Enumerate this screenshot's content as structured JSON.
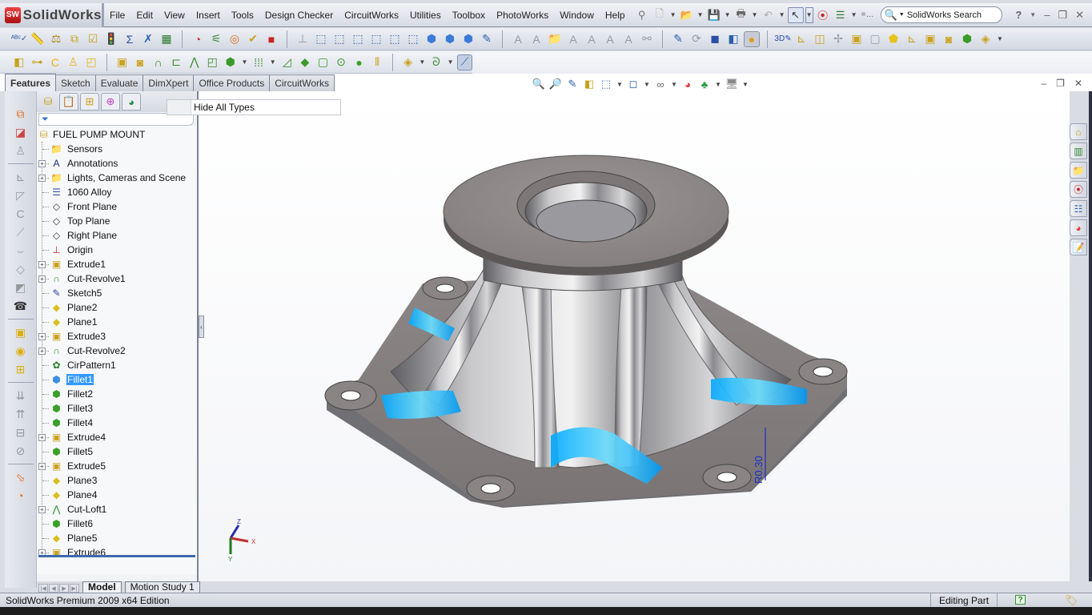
{
  "app": {
    "brand": "SolidWorks",
    "brand_badge": "SW"
  },
  "menu": [
    "File",
    "Edit",
    "View",
    "Insert",
    "Tools",
    "Design Checker",
    "CircuitWorks",
    "Utilities",
    "Toolbox",
    "PhotoWorks",
    "Window",
    "Help"
  ],
  "search": {
    "placeholder": "SolidWorks Search",
    "value": "SolidWorks Search"
  },
  "window_controls": {
    "help": "?",
    "minimize": "–",
    "restore": "❐",
    "close": "✕"
  },
  "command_tabs": [
    {
      "label": "Features",
      "active": true
    },
    {
      "label": "Sketch",
      "active": false
    },
    {
      "label": "Evaluate",
      "active": false
    },
    {
      "label": "DimXpert",
      "active": false
    },
    {
      "label": "Office Products",
      "active": false
    },
    {
      "label": "CircuitWorks",
      "active": false
    }
  ],
  "filter_popup": {
    "label": "Hide All Types"
  },
  "feature_tree": {
    "root": "FUEL PUMP MOUNT",
    "items": [
      {
        "label": "Sensors",
        "icon": "sensors-folder-icon",
        "expandable": false
      },
      {
        "label": "Annotations",
        "icon": "annotations-icon",
        "expandable": true
      },
      {
        "label": "Lights, Cameras and Scene",
        "icon": "lights-folder-icon",
        "expandable": true
      },
      {
        "label": "1060 Alloy",
        "icon": "material-icon",
        "expandable": false
      },
      {
        "label": "Front Plane",
        "icon": "plane-icon",
        "expandable": false
      },
      {
        "label": "Top Plane",
        "icon": "plane-icon",
        "expandable": false
      },
      {
        "label": "Right Plane",
        "icon": "plane-icon",
        "expandable": false
      },
      {
        "label": "Origin",
        "icon": "origin-icon",
        "expandable": false
      },
      {
        "label": "Extrude1",
        "icon": "extrude-icon",
        "expandable": true
      },
      {
        "label": "Cut-Revolve1",
        "icon": "cut-revolve-icon",
        "expandable": true
      },
      {
        "label": "Sketch5",
        "icon": "sketch-icon",
        "expandable": false
      },
      {
        "label": "Plane2",
        "icon": "ref-plane-icon",
        "expandable": false
      },
      {
        "label": "Plane1",
        "icon": "ref-plane-icon",
        "expandable": false
      },
      {
        "label": "Extrude3",
        "icon": "extrude-icon",
        "expandable": true
      },
      {
        "label": "Cut-Revolve2",
        "icon": "cut-revolve-icon",
        "expandable": true
      },
      {
        "label": "CirPattern1",
        "icon": "circular-pattern-icon",
        "expandable": false
      },
      {
        "label": "Fillet1",
        "icon": "fillet-icon",
        "expandable": false,
        "selected": true
      },
      {
        "label": "Fillet2",
        "icon": "fillet-icon",
        "expandable": false
      },
      {
        "label": "Fillet3",
        "icon": "fillet-icon",
        "expandable": false
      },
      {
        "label": "Fillet4",
        "icon": "fillet-icon",
        "expandable": false
      },
      {
        "label": "Extrude4",
        "icon": "extrude-icon",
        "expandable": true
      },
      {
        "label": "Fillet5",
        "icon": "fillet-icon",
        "expandable": false
      },
      {
        "label": "Extrude5",
        "icon": "extrude-icon",
        "expandable": true
      },
      {
        "label": "Plane3",
        "icon": "ref-plane-icon",
        "expandable": false
      },
      {
        "label": "Plane4",
        "icon": "ref-plane-icon",
        "expandable": false
      },
      {
        "label": "Cut-Loft1",
        "icon": "cut-loft-icon",
        "expandable": true
      },
      {
        "label": "Fillet6",
        "icon": "fillet-icon",
        "expandable": false
      },
      {
        "label": "Plane5",
        "icon": "ref-plane-icon",
        "expandable": false
      },
      {
        "label": "Extrude6",
        "icon": "extrude-icon",
        "expandable": true
      }
    ]
  },
  "bottom_tabs": [
    {
      "label": "Model",
      "active": true
    },
    {
      "label": "Motion Study 1",
      "active": false
    }
  ],
  "triad": {
    "x": "X",
    "y": "Y",
    "z": "Z"
  },
  "dimension_label": "R0.30",
  "status": {
    "edition": "SolidWorks Premium 2009 x64 Edition",
    "mode": "Editing Part",
    "help": "?"
  },
  "colors": {
    "selection": "#3399ff",
    "highlight_fillet": "#1ec8ff",
    "part_gray": "#8e8e92"
  }
}
